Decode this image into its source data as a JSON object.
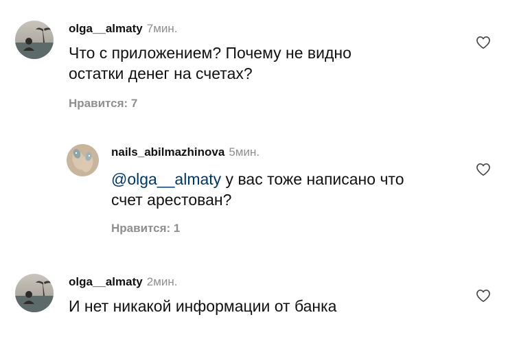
{
  "comments": [
    {
      "username": "olga__almaty",
      "time": "7мин.",
      "text_line1": "Что с приложением? Почему не видно",
      "text_line2": "остатки денег на счетах?",
      "likes": "Нравится: 7",
      "like_icon": "heart-outline-icon"
    },
    {
      "username": "nails_abilmazhinova",
      "time": "5мин.",
      "mention": "@olga__almaty",
      "text_line1_rest": " у вас тоже написано что",
      "text_line2": "счет арестован?",
      "likes": "Нравится: 1",
      "like_icon": "heart-outline-icon"
    },
    {
      "username": "olga__almaty",
      "time": "2мин.",
      "text_line1": "И нет никакой информации от банка",
      "like_icon": "heart-outline-icon"
    }
  ],
  "colors": {
    "text": "#111111",
    "secondary": "#8e8e8e",
    "mention": "#00376b"
  }
}
